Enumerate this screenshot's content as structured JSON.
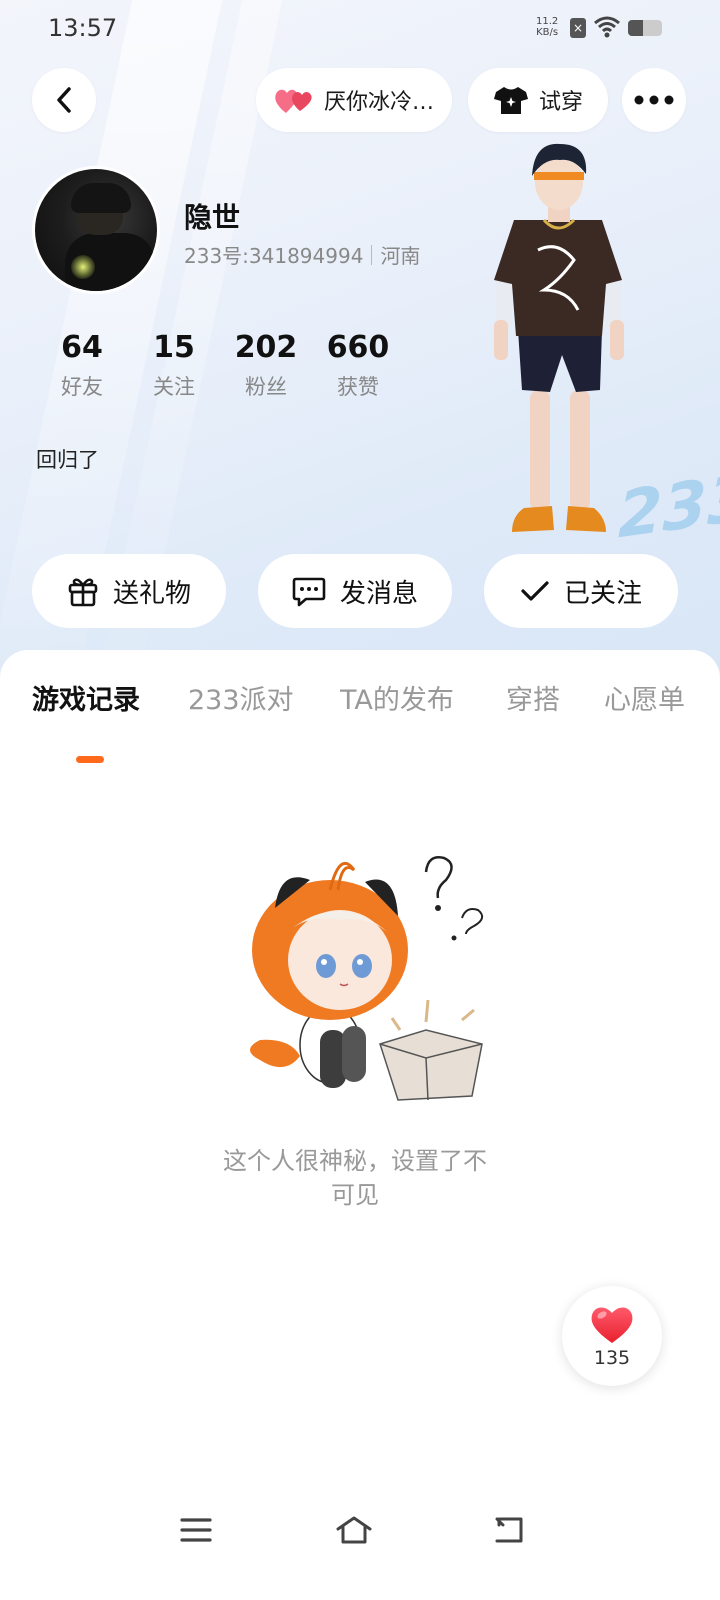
{
  "status_bar": {
    "time": "13:57",
    "net_speed_value": "11.2",
    "net_speed_unit": "KB/s",
    "sim_icon": "sim-off-icon",
    "wifi_icon": "wifi-icon",
    "battery_level": 0.45
  },
  "top_bar": {
    "back_icon": "chevron-left-icon",
    "song_label": "厌你冰冷…",
    "song_icon": "hearts-icon",
    "tryon_label": "试穿",
    "tryon_icon": "tshirt-icon",
    "more_icon": "more-dots-icon"
  },
  "profile": {
    "name": "隐世",
    "uid": "233号:341894994",
    "region": "河南",
    "bio": "回归了",
    "stats": [
      {
        "value": "64",
        "label": "好友"
      },
      {
        "value": "15",
        "label": "关注"
      },
      {
        "value": "202",
        "label": "粉丝"
      },
      {
        "value": "660",
        "label": "获赞"
      }
    ],
    "badge_text": "233"
  },
  "actions": {
    "gift": {
      "label": "送礼物",
      "icon": "gift-icon"
    },
    "message": {
      "label": "发消息",
      "icon": "chat-bubble-icon"
    },
    "follow": {
      "label": "已关注",
      "icon": "check-icon"
    }
  },
  "tabs": [
    {
      "label": "游戏记录",
      "active": true
    },
    {
      "label": "233派对",
      "active": false
    },
    {
      "label": "TA的发布",
      "active": false
    },
    {
      "label": "穿搭",
      "active": false
    },
    {
      "label": "心愿单",
      "active": false
    }
  ],
  "empty_state": {
    "text_line1": "这个人很神秘，设置了不",
    "text_line2": "可见"
  },
  "like_float": {
    "count": "135",
    "icon": "heart-icon"
  },
  "nav": {
    "menu_icon": "menu-icon",
    "home_icon": "home-icon",
    "back_icon": "return-icon"
  },
  "colors": {
    "accent": "#ff6a1a",
    "heart": "#f23a4a",
    "muted_text": "#888888"
  }
}
